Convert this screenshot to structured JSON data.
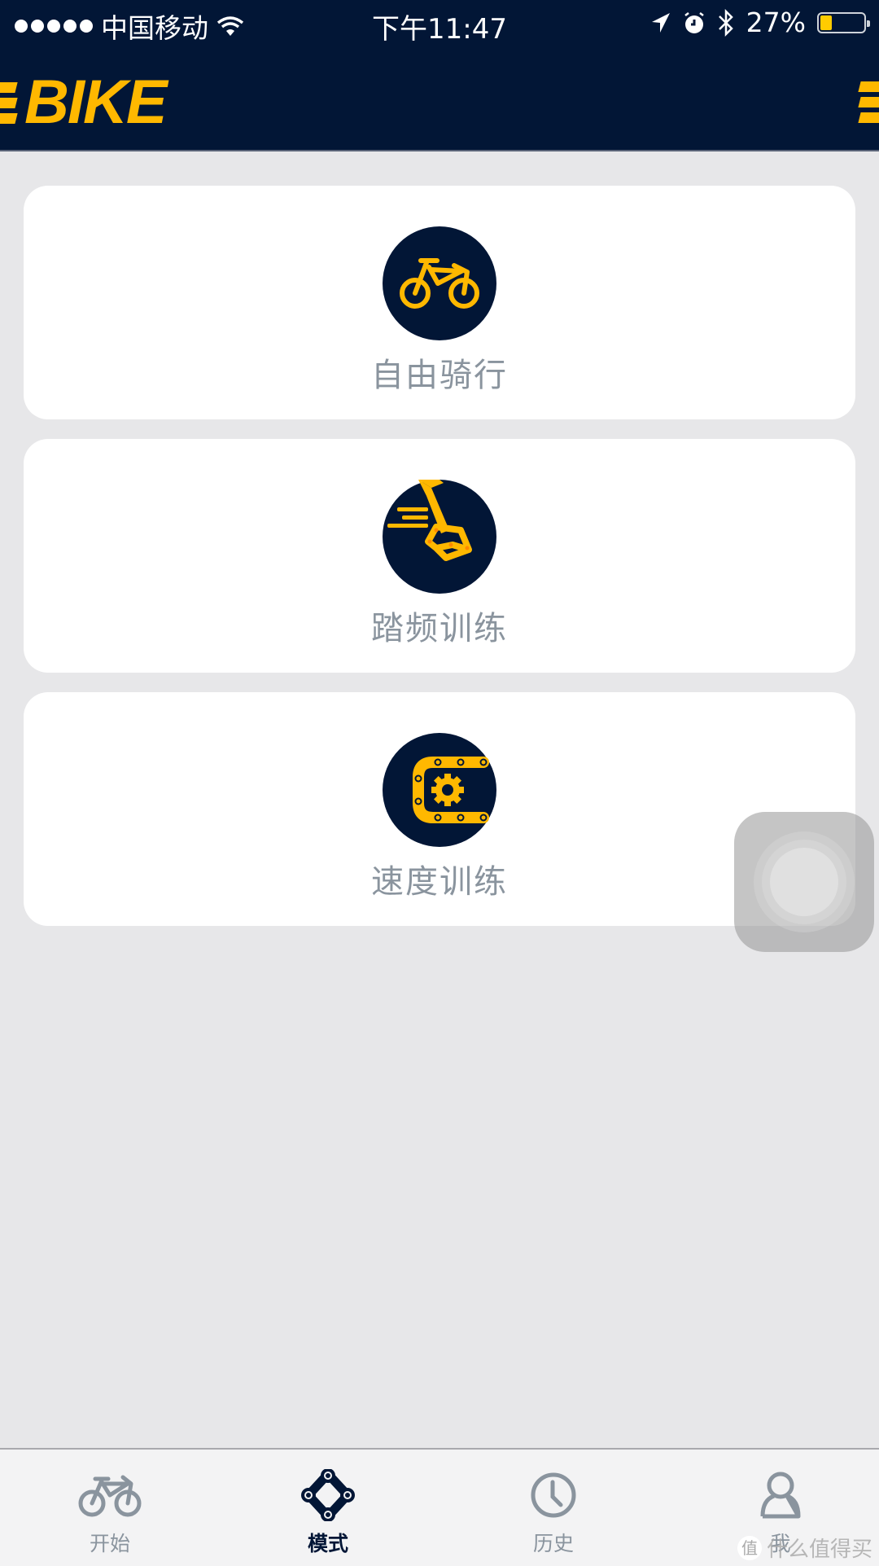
{
  "status_bar": {
    "carrier": "中国移动",
    "time": "下午11:47",
    "battery_percent_label": "27%",
    "battery_level": 0.27,
    "icons": [
      "signal-dots-icon",
      "wifi-icon",
      "location-arrow-icon",
      "alarm-icon",
      "bluetooth-icon",
      "battery-icon"
    ]
  },
  "header": {
    "logo_text": "BIKE",
    "colors": {
      "background": "#021636",
      "accent": "#ffb800"
    }
  },
  "modes": [
    {
      "label": "自由骑行",
      "icon": "bicycle-icon"
    },
    {
      "label": "踏频训练",
      "icon": "pedal-icon"
    },
    {
      "label": "速度训练",
      "icon": "chain-gear-icon"
    }
  ],
  "tabbar": {
    "tabs": [
      {
        "label": "开始",
        "icon": "bicycle-icon",
        "active": false
      },
      {
        "label": "模式",
        "icon": "chain-link-icon",
        "active": true
      },
      {
        "label": "历史",
        "icon": "clock-icon",
        "active": false
      },
      {
        "label": "我",
        "icon": "user-icon",
        "active": false
      }
    ]
  },
  "watermark": {
    "badge": "值",
    "text": "什么值得买"
  }
}
